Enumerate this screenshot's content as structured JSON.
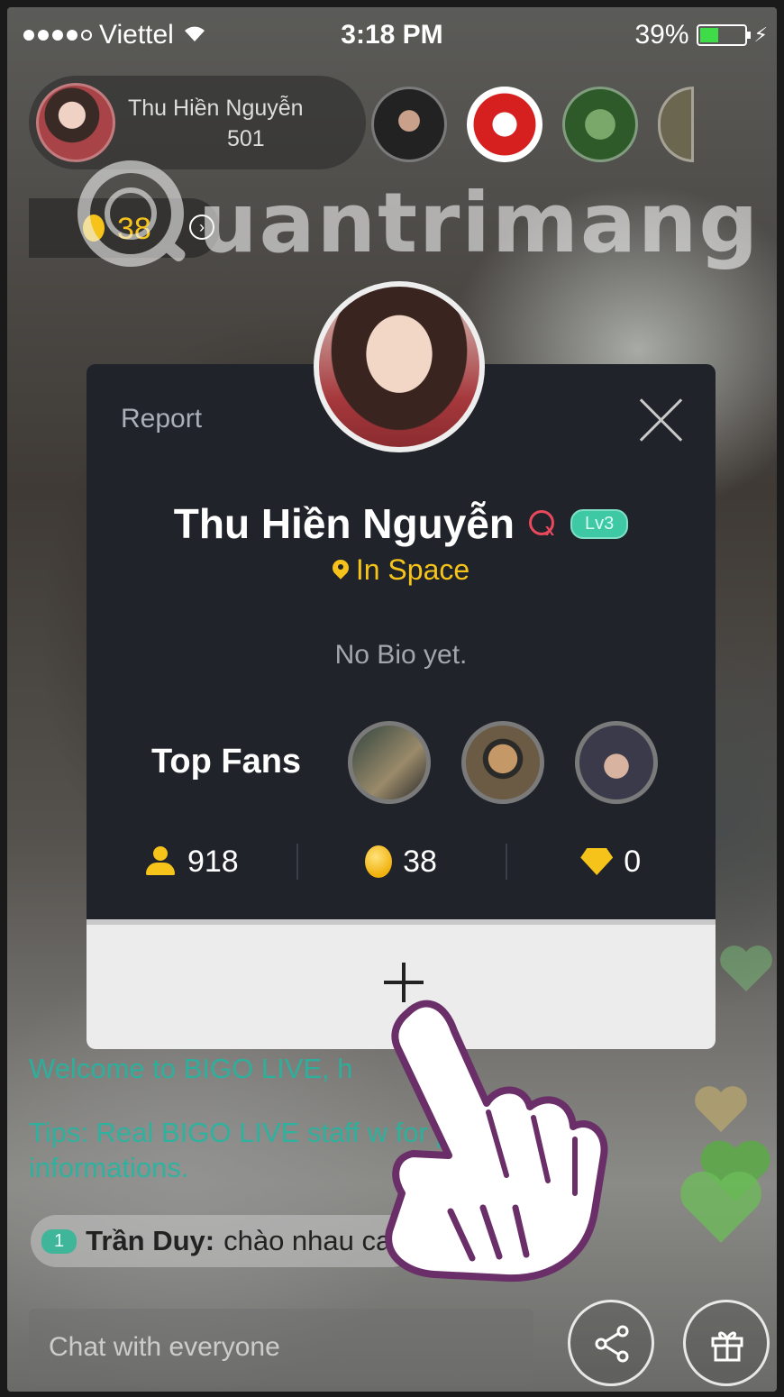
{
  "status_bar": {
    "carrier": "Viettel",
    "time": "3:18 PM",
    "battery": "39%"
  },
  "host": {
    "name": "Thu Hiền Nguyễn",
    "count": "501",
    "coins": "38"
  },
  "watermark": {
    "text": "uantrimang"
  },
  "profile_card": {
    "report_label": "Report",
    "name": "Thu Hiền Nguyễn",
    "level": "Lv3",
    "location": "In Space",
    "bio": "No Bio yet.",
    "top_fans_label": "Top Fans",
    "stats": {
      "fans": "918",
      "beans": "38",
      "diamonds": "0"
    }
  },
  "chat": {
    "welcome": "Welcome to BIGO LIVE, h",
    "tips": "Tips: Real BIGO LIVE staff w                    for personal informations.",
    "message": {
      "level": "1",
      "user": "Trần Duy:",
      "text": "chào nhau cai"
    },
    "input_placeholder": "Chat with everyone"
  },
  "colors": {
    "accent_gold": "#f5c319",
    "chat_teal": "#1fb8a2",
    "level_green": "#3fc8a4",
    "card_bg": "#20232a"
  }
}
